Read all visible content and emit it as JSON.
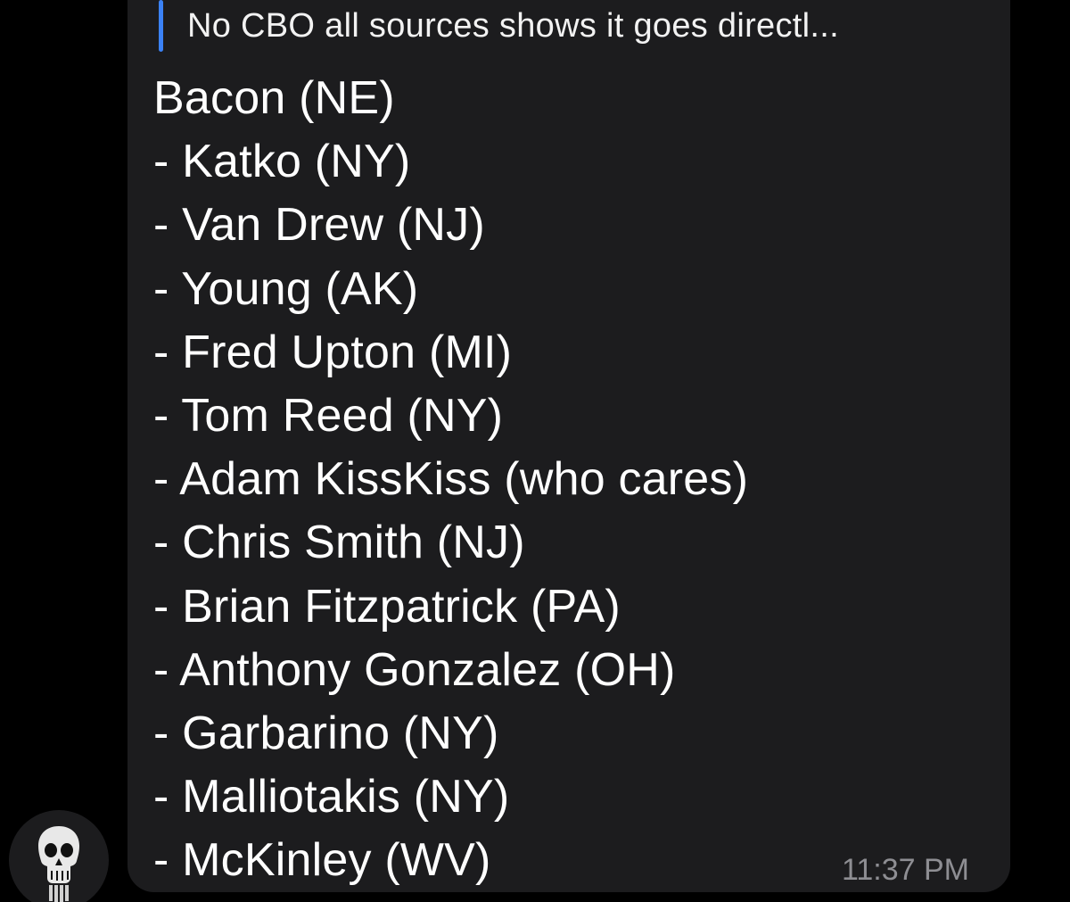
{
  "reply": {
    "quoted_text": "No CBO all sources shows it goes directl...",
    "accent_color": "#3b82f6"
  },
  "message": {
    "lines": [
      "Bacon (NE)",
      "- Katko (NY)",
      "- Van Drew (NJ)",
      "- Young (AK)",
      "- Fred Upton (MI)",
      "- Tom Reed (NY)",
      "- Adam KissKiss (who cares)",
      "- Chris Smith (NJ)",
      "- Brian Fitzpatrick (PA)",
      "- Anthony Gonzalez (OH)",
      "- Garbarino (NY)",
      "- Malliotakis (NY)",
      "- McKinley (WV)"
    ],
    "timestamp": "11:37 PM"
  },
  "sender": {
    "avatar_icon": "skull-icon"
  },
  "colors": {
    "background": "#000000",
    "bubble": "#1c1c1e",
    "text": "#ffffff",
    "timestamp": "#8e8e93"
  }
}
